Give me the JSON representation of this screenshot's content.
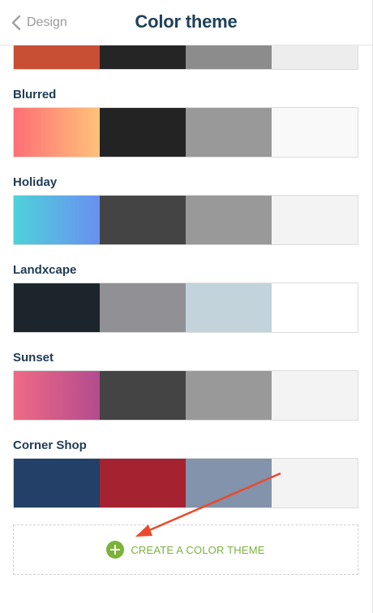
{
  "header": {
    "back_label": "Design",
    "title": "Color theme"
  },
  "themes": [
    {
      "name": "",
      "colors": [
        "#c84f34",
        "#252525",
        "#8c8c8c",
        "#ededed"
      ],
      "gradient": null
    },
    {
      "name": "Blurred",
      "colors": [
        "#fe6d73",
        "#232323",
        "#999999",
        "#f9f9f9"
      ],
      "gradient": [
        "#fe6f76",
        "#ffc27a"
      ]
    },
    {
      "name": "Holiday",
      "colors": [
        "#4ecfdc",
        "#444444",
        "#999999",
        "#f3f3f3"
      ],
      "gradient": [
        "#4ed2da",
        "#6a8ff0"
      ]
    },
    {
      "name": "Landxcape",
      "colors": [
        "#1c252b",
        "#919195",
        "#c2d3dc",
        "#ffffff"
      ],
      "gradient": null
    },
    {
      "name": "Sunset",
      "colors": [
        "#e96186",
        "#444444",
        "#999999",
        "#f3f3f3"
      ],
      "gradient": [
        "#ef6a85",
        "#b34b8f"
      ]
    },
    {
      "name": "Corner Shop",
      "colors": [
        "#224068",
        "#a52231",
        "#8293ab",
        "#f3f3f3"
      ],
      "gradient": null
    }
  ],
  "create": {
    "label": "CREATE A COLOR THEME"
  },
  "colors": {
    "title": "#1f4159",
    "accent_green": "#7bb23a",
    "annotation_arrow": "#ea4a2c"
  },
  "icons": {
    "back": "chevron-left-icon",
    "add": "plus-circle-icon"
  }
}
